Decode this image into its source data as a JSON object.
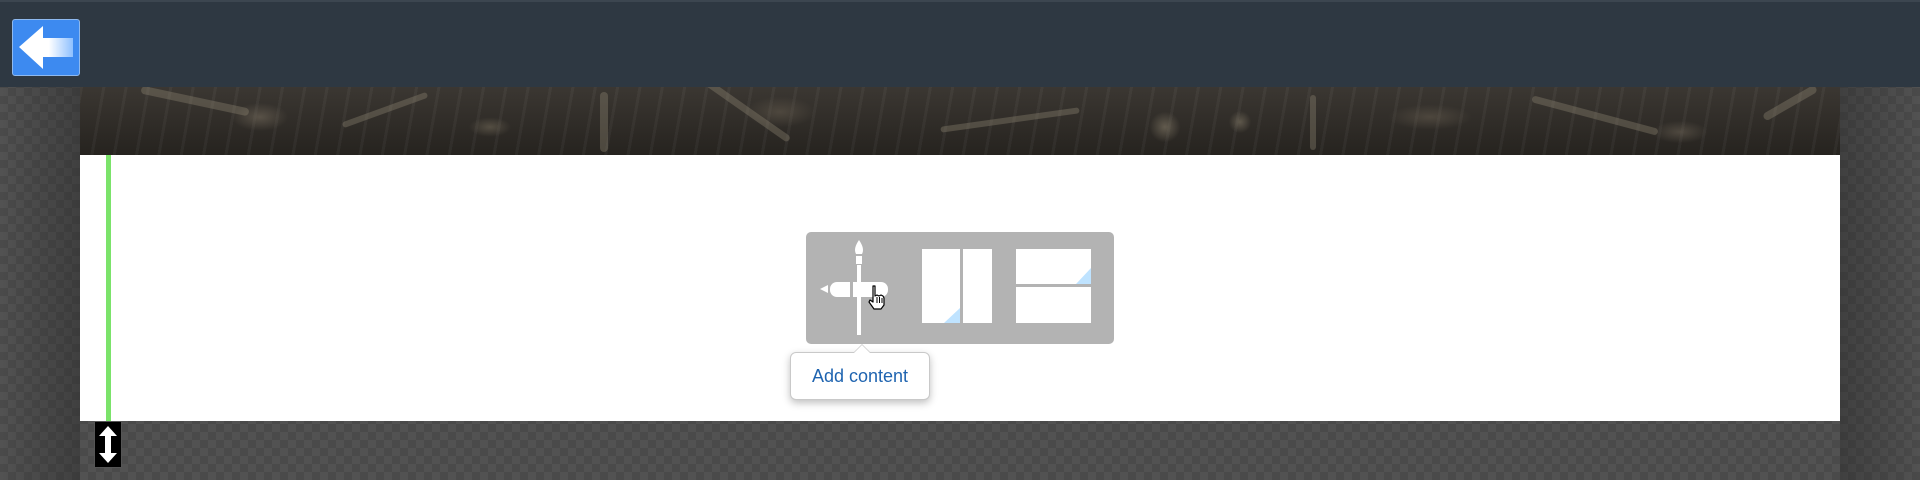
{
  "header": {
    "back_button": {
      "icon": "arrow-left-icon",
      "accent": "#3d8af0"
    }
  },
  "hero": {
    "description_icon": "tools-banner"
  },
  "content_section": {
    "guide_color": "#7be36a",
    "toolbar": {
      "items": [
        {
          "name": "add-content",
          "icon": "brush-pencil-cross-icon"
        },
        {
          "name": "columns-layout",
          "icon": "columns-layout-icon"
        },
        {
          "name": "rows-layout",
          "icon": "rows-layout-icon"
        }
      ]
    },
    "tooltip": {
      "text": "Add content"
    }
  },
  "resize_handle": {
    "icon": "vertical-resize-icon"
  }
}
